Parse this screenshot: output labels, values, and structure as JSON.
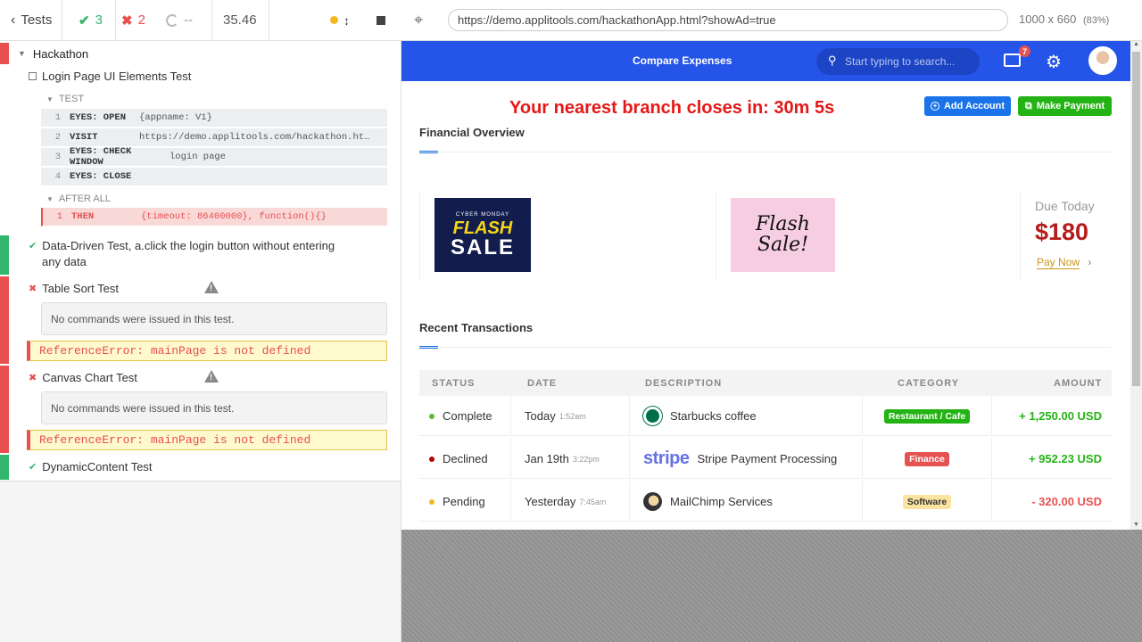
{
  "runner": {
    "back_label": "Tests",
    "passed_count": "3",
    "failed_count": "2",
    "pending_count": "--",
    "duration": "35.46",
    "suite_title": "Hackathon",
    "test1": {
      "title": "Login Page UI Elements Test",
      "section_test": "TEST",
      "commands": [
        {
          "num": "1",
          "name": "EYES: OPEN",
          "message": "{appname: V1}"
        },
        {
          "num": "2",
          "name": "VISIT",
          "message": "https://demo.applitools.com/hackathon.ht…"
        },
        {
          "num": "3",
          "name": "EYES: CHECK WINDOW",
          "message": "login page"
        },
        {
          "num": "4",
          "name": "EYES: CLOSE",
          "message": ""
        }
      ],
      "section_after": "AFTER ALL",
      "after_cmd": {
        "num": "1",
        "name": "THEN",
        "message": "{timeout: 86400000}, function(){}"
      }
    },
    "test2": {
      "title_line1": "Data-Driven Test, a.click the login button without entering",
      "title_line2": "any data"
    },
    "test3": {
      "title": "Table Sort Test",
      "no_commands": "No commands were issued in this test.",
      "error": "ReferenceError: mainPage is not defined"
    },
    "test4": {
      "title": "Canvas Chart Test",
      "no_commands": "No commands were issued in this test.",
      "error": "ReferenceError: mainPage is not defined"
    },
    "test5": {
      "title": "DynamicContent Test"
    }
  },
  "browser": {
    "url": "https://demo.applitools.com/hackathonApp.html?showAd=true",
    "viewport": "1000 x 660",
    "zoom": "(83%)"
  },
  "app": {
    "nav_title": "Compare Expenses",
    "search_placeholder": "Start typing to search...",
    "notif_count": "7",
    "countdown": "Your nearest branch closes in: 30m 5s",
    "add_account": "Add Account",
    "make_payment": "Make Payment",
    "financial_overview": "Financial Overview",
    "ad1": {
      "small": "CYBER MONDAY",
      "big1": "FLASH",
      "big2": "SALE"
    },
    "ad2": {
      "text1": "Flash",
      "text2": "Sale!"
    },
    "due_label": "Due Today",
    "due_amount": "$180",
    "pay_now": "Pay Now",
    "recent_transactions": "Recent Transactions",
    "headers": {
      "status": "STATUS",
      "date": "DATE",
      "description": "DESCRIPTION",
      "category": "CATEGORY",
      "amount": "AMOUNT"
    },
    "rows": [
      {
        "status": "Complete",
        "status_color": "#5fb832",
        "date": "Today",
        "time": "1:52am",
        "description": "Starbucks coffee",
        "category": "Restaurant / Cafe",
        "cat_bg": "#24b314",
        "cat_fg": "#ffffff",
        "amount": "+ 1,250.00 USD",
        "amount_color": "#24b314"
      },
      {
        "status": "Declined",
        "status_color": "#b30000",
        "date": "Jan 19th",
        "time": "3:22pm",
        "description": "Stripe Payment Processing",
        "category": "Finance",
        "cat_bg": "#e65252",
        "cat_fg": "#ffffff",
        "amount": "+ 952.23 USD",
        "amount_color": "#24b314"
      },
      {
        "status": "Pending",
        "status_color": "#f3b61f",
        "date": "Yesterday",
        "time": "7:45am",
        "description": "MailChimp Services",
        "category": "Software",
        "cat_bg": "#fbe4a0",
        "cat_fg": "#333333",
        "amount": "- 320.00 USD",
        "amount_color": "#e65252"
      }
    ]
  }
}
